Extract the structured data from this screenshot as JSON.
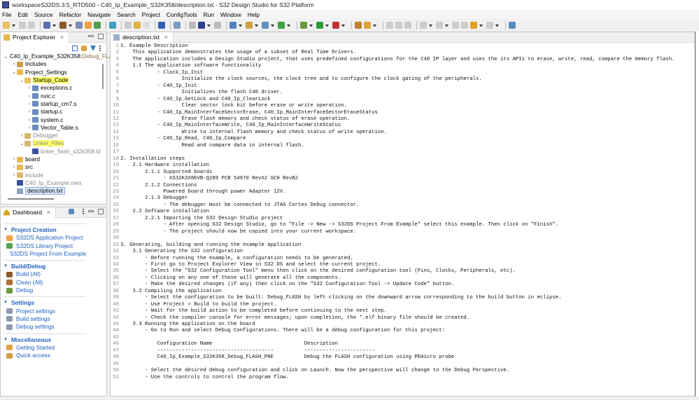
{
  "window": {
    "title": "workspaceS32DS.3.5_RTD500 - C40_Ip_Example_S32K358/description.txt - S32 Design Studio for S32 Platform"
  },
  "menu": [
    "File",
    "Edit",
    "Source",
    "Refactor",
    "Navigate",
    "Search",
    "Project",
    "ConfigTools",
    "Run",
    "Window",
    "Help"
  ],
  "toolbar": {
    "icons": [
      {
        "name": "new-icon",
        "color": "#e8c060"
      },
      {
        "name": "dd"
      },
      {
        "name": "save-icon",
        "color": "#ccc"
      },
      {
        "name": "save-all-icon",
        "color": "#ccc"
      },
      {
        "name": "sep"
      },
      {
        "name": "build-config-icon",
        "color": "#5a6fb0"
      },
      {
        "name": "dd"
      },
      {
        "name": "hammer-build-icon",
        "color": "#8a5a2a"
      },
      {
        "name": "dd"
      },
      {
        "name": "build-all-icon",
        "color": "#7a8ab0"
      },
      {
        "name": "new-app-project-icon",
        "color": "#f0a040"
      },
      {
        "name": "new-library-icon",
        "color": "#50a050"
      },
      {
        "name": "sep"
      },
      {
        "name": "project-from-example-icon",
        "color": "#40a0c0"
      },
      {
        "name": "sep"
      },
      {
        "name": "file-icon",
        "color": "#ccc"
      },
      {
        "name": "undo-icon",
        "color": "#e0b040"
      },
      {
        "name": "redo-icon",
        "color": "#ddd"
      },
      {
        "name": "sep"
      },
      {
        "name": "terminal-icon",
        "color": "#3060b0"
      },
      {
        "name": "sep"
      },
      {
        "name": "search-icon",
        "color": "#7a9ac0"
      },
      {
        "name": "sep"
      },
      {
        "name": "step-icon",
        "color": "#bbb"
      },
      {
        "name": "stop-icon",
        "color": "#2a3f8f"
      },
      {
        "name": "dd"
      },
      {
        "name": "pin-icon",
        "color": "#bbb"
      },
      {
        "name": "sep"
      },
      {
        "name": "new-class-icon",
        "color": "#5080c0"
      },
      {
        "name": "dd"
      },
      {
        "name": "new-folder-icon",
        "color": "#d0a040"
      },
      {
        "name": "dd"
      },
      {
        "name": "new-source-icon",
        "color": "#6090c0"
      },
      {
        "name": "dd"
      },
      {
        "name": "new-c-icon",
        "color": "#40a040"
      },
      {
        "name": "dd"
      },
      {
        "name": "sep"
      },
      {
        "name": "debug-icon",
        "color": "#6a9a3a"
      },
      {
        "name": "dd"
      },
      {
        "name": "run-icon",
        "color": "#2a9a3a"
      },
      {
        "name": "dd"
      },
      {
        "name": "external-tools-icon",
        "color": "#c03030"
      },
      {
        "name": "dd"
      },
      {
        "name": "sep"
      },
      {
        "name": "open-perspective-icon",
        "color": "#c08030"
      },
      {
        "name": "wrench-icon",
        "color": "#e0a040"
      },
      {
        "name": "dd"
      },
      {
        "name": "sep"
      },
      {
        "name": "toggle-mark-icon",
        "color": "#ccc"
      },
      {
        "name": "block-select-icon",
        "color": "#ccc"
      },
      {
        "name": "show-whitespace-icon",
        "color": "#ccc"
      },
      {
        "name": "sep"
      },
      {
        "name": "next-annotation-icon",
        "color": "#ccc"
      },
      {
        "name": "dd"
      },
      {
        "name": "prev-annotation-icon",
        "color": "#ccc"
      },
      {
        "name": "dd"
      },
      {
        "name": "last-edit-icon",
        "color": "#ccc"
      },
      {
        "name": "back-history-icon",
        "color": "#ccc"
      },
      {
        "name": "back-icon",
        "color": "#e0a020"
      },
      {
        "name": "dd"
      },
      {
        "name": "forward-icon",
        "color": "#ccc"
      },
      {
        "name": "dd"
      },
      {
        "name": "sep"
      },
      {
        "name": "new-window-icon",
        "color": "#5a8ac0"
      }
    ]
  },
  "explorer": {
    "tab_label": "Project Explorer",
    "tree": [
      {
        "depth": 0,
        "tw": "v",
        "label": "C40_Ip_Example_S32K358:",
        "deco": " Debug_FLASH",
        "icon": "#4a7ac0"
      },
      {
        "depth": 1,
        "tw": ">",
        "label": "Includes",
        "icon": "#c8a050"
      },
      {
        "depth": 1,
        "tw": "v",
        "label": "Project_Settings",
        "icon": "#e8b850"
      },
      {
        "depth": 2,
        "tw": "v",
        "label": "Startup_Code",
        "icon": "#e8c060",
        "hl": true
      },
      {
        "depth": 3,
        "tw": ">",
        "label": "exceptions.c",
        "icon": "#6a8ac0"
      },
      {
        "depth": 3,
        "tw": ">",
        "label": "nvic.c",
        "icon": "#6a8ac0"
      },
      {
        "depth": 3,
        "tw": ">",
        "label": "startup_cm7.s",
        "icon": "#6a8ac0"
      },
      {
        "depth": 3,
        "tw": ">",
        "label": "startup.c",
        "icon": "#6a8ac0"
      },
      {
        "depth": 3,
        "tw": ">",
        "label": "system.c",
        "icon": "#6a8ac0"
      },
      {
        "depth": 3,
        "tw": ">",
        "label": "Vector_Table.s",
        "icon": "#6a8ac0"
      },
      {
        "depth": 2,
        "tw": ">",
        "label": "Debugger",
        "icon": "#d8b870",
        "gray": true
      },
      {
        "depth": 2,
        "tw": "v",
        "label": "Linker_Files",
        "icon": "#d8b870",
        "hl": true,
        "gray": true
      },
      {
        "depth": 3,
        "tw": "",
        "label": "linker_flash_s32k358.ld",
        "icon": "#3a4f9c",
        "gray": true
      },
      {
        "depth": 1,
        "tw": ">",
        "label": "board",
        "icon": "#e8b850"
      },
      {
        "depth": 1,
        "tw": ">",
        "label": "src",
        "icon": "#e8b850"
      },
      {
        "depth": 1,
        "tw": ">",
        "label": "include",
        "icon": "#d8b870",
        "gray": true
      },
      {
        "depth": 1,
        "tw": "",
        "label": "C40_Ip_Example.mex",
        "icon": "#3a4f9c",
        "gray": true
      },
      {
        "depth": 1,
        "tw": "",
        "label": "description.txt",
        "icon": "#8aa0c0",
        "sel": true
      }
    ]
  },
  "dashboard": {
    "tab_label": "Dashboard",
    "sections": [
      {
        "title": "Project Creation",
        "items": [
          {
            "label": "S32DS Application Project",
            "icon": "#f0a040"
          },
          {
            "label": "S32DS Library Project",
            "icon": "#50a050"
          },
          {
            "label": "S32DS Project From Example",
            "icon": "#40a0c0"
          }
        ]
      },
      {
        "title": "Build/Debug",
        "items": [
          {
            "label": "Build   (All)",
            "icon": "#8a5a2a"
          },
          {
            "label": "Clean   (All)",
            "icon": "#b07030"
          },
          {
            "label": "Debug",
            "icon": "#6a9a3a"
          }
        ]
      },
      {
        "title": "Settings",
        "items": [
          {
            "label": "Project settings",
            "icon": "#8a9ab0"
          },
          {
            "label": "Build settings",
            "icon": "#8a9ab0"
          },
          {
            "label": "Debug settings",
            "icon": "#8a9ab0"
          }
        ]
      },
      {
        "title": "Miscellaneous",
        "items": [
          {
            "label": "Getting Started",
            "icon": "#e0a040"
          },
          {
            "label": "Quick access",
            "icon": "#d0a040"
          }
        ]
      }
    ]
  },
  "editor": {
    "tab_label": "description.txt",
    "lines": [
      "1. Example Description",
      "    This application demonstrates the usage of a subset of Real Time Drivers.",
      "    The application includes a Design Studio project, that uses predefined configurations for the C40 IP layer and uses the its APIs to erase, write, read, compare the memory flash.",
      "    1.1 The application software functionality",
      "            - Clock_Ip_Init",
      "                    Initialize the clock sources, the clock tree and to configure the clock gating of the peripherals.",
      "            - C40_Ip_Init",
      "                    Initializes the flash C40 driver.",
      "            - C40_Ip_GetLock and C40_Ip_ClearLock",
      "                    Clear sector lock bit before erase or write operation.",
      "            - C40_Ip_MainInterfaceSectorErase, C40_Ip_MainInterfaceSectorEraseStatus",
      "                    Erase flash memory and check status of erase operation.",
      "            - C40_Ip_MainInterfaceWrite, C40_Ip_MainInterfaceWriteStatus",
      "                    Write to internal flash memory and check status of write operation.",
      "            - C40_Ip_Read, C40_Ip_Compare",
      "                    Read and compare data in internal flash.",
      "",
      "2. Installation steps",
      "    2.1 Hardware installation",
      "        2.1.1 Supported boards",
      "              - XS32K3X8EVB-Q289 PCB 54870 RevX2 SCH RevB2",
      "        2.1.2 Connections",
      "              Powered board through power Adapter 12V.",
      "        2.1.3 Debugger",
      "              - The debugger must be connected to JTAG Cortex Debug connector.",
      "    2.2 Software installation",
      "        2.2.1 Importing the S32 Design Studio project",
      "              - After opening S32 Design Studio, go to \"File -> New -> S32DS Project From Example\" select this example. Then click on \"Finish\".",
      "              - The project should now be copied into your current workspace.",
      "",
      "3. Generating, building and running the example application",
      "    3.1 Generating the S32 configuration",
      "        - Before running the example, a configuration needs to be generated.",
      "        - First go to Project Explorer View in S32 DS and select the current project.",
      "        - Select the \"S32 Configuration Tool\" menu then click on the desired configuration tool (Pins, Clocks, Peripherals, etc).",
      "        - Clicking on any one of those will generate all the components.",
      "        - Make the desired changes (if any) then click on the \"S32 Configuration Tool -> Update Code\" button.",
      "    3.2 Compiling the application",
      "        - Select the configuration to be built: Debug_FLASH by left clicking on the downward arrow corresponding to the build button in eclipse.",
      "        - Use Project > Build to build the project.",
      "        - Wait for the build action to be completed before continuing to the next step.",
      "        - Check the compiler console for error messages; upon completion, the *.elf binary file should be created.",
      "    3.3 Running the application on the board",
      "        - Go to Run and select Debug Configurations. There will be a debug configuration for this project:",
      "",
      "            Configuration Name                              Description",
      "            --------------------------------------          -----------------------",
      "            C40_Ip_Example_S32K358_Debug_FLASH_PNE          Debug the FLASH configuration using PEmicro probe",
      "",
      "        - Select the desired debug configuration and click on Launch. Now the perspective will change to the Debug Perspective.",
      "        - Use the controls to control the program flow."
    ]
  }
}
